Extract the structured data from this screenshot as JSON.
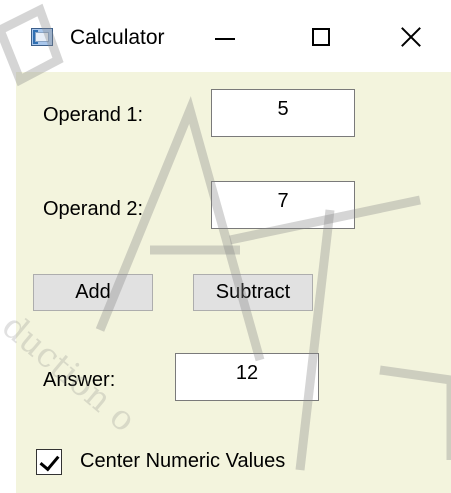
{
  "window": {
    "title": "Calculator"
  },
  "form": {
    "operand1_label": "Operand 1:",
    "operand1_value": "5",
    "operand2_label": "Operand 2:",
    "operand2_value": "7",
    "add_label": "Add",
    "subtract_label": "Subtract",
    "answer_label": "Answer:",
    "answer_value": "12",
    "center_checkbox_label": "Center Numeric Values",
    "center_checkbox_checked": true
  },
  "colors": {
    "client_background": "#f3f4dd",
    "button_face": "#e1e1e1"
  },
  "icons": [
    "calculator-app-icon",
    "minimize-icon",
    "maximize-icon",
    "close-icon",
    "checkmark-icon"
  ]
}
